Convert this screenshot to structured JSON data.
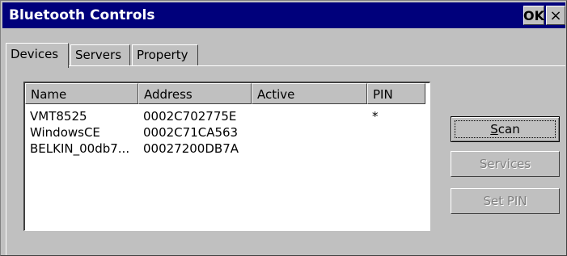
{
  "window": {
    "title": "Bluetooth Controls",
    "ok_label": "OK",
    "close_label": "×"
  },
  "tabs": [
    {
      "label": "Devices",
      "active": true
    },
    {
      "label": "Servers",
      "active": false
    },
    {
      "label": "Property",
      "active": false
    }
  ],
  "devices_list": {
    "columns": [
      "Name",
      "Address",
      "Active",
      "PIN"
    ],
    "rows": [
      {
        "name": "VMT8525",
        "address": "0002C702775E",
        "active": "",
        "pin": "*"
      },
      {
        "name": "WindowsCE",
        "address": "0002C71CA563",
        "active": "",
        "pin": ""
      },
      {
        "name": "BELKIN_00db7...",
        "address": "00027200DB7A",
        "active": "",
        "pin": ""
      }
    ]
  },
  "buttons": {
    "scan_label_mnemonic": "S",
    "scan_label_rest": "can",
    "services_label": "Services",
    "set_pin_label": "Set PIN"
  }
}
